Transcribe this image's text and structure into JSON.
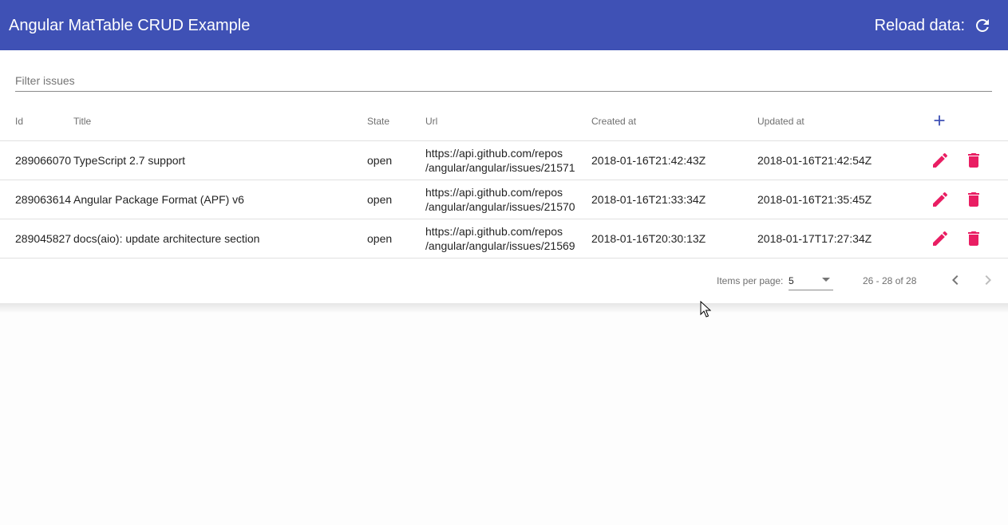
{
  "toolbar": {
    "title": "Angular MatTable CRUD Example",
    "reload_label": "Reload data:",
    "reload_icon": "refresh-icon",
    "background": "#3f51b5"
  },
  "filter": {
    "placeholder": "Filter issues",
    "value": ""
  },
  "table": {
    "columns": [
      "Id",
      "Title",
      "State",
      "Url",
      "Created at",
      "Updated at"
    ],
    "add_icon": "add-icon",
    "action_color": "#e91e63",
    "rows": [
      {
        "id": "289066070",
        "title": "TypeScript 2.7 support",
        "state": "open",
        "url_line1": "https://api.github.com/repos",
        "url_line2": "/angular/angular/issues/21571",
        "created_at": "2018-01-16T21:42:43Z",
        "updated_at": "2018-01-16T21:42:54Z"
      },
      {
        "id": "289063614",
        "title": "Angular Package Format (APF) v6",
        "state": "open",
        "url_line1": "https://api.github.com/repos",
        "url_line2": "/angular/angular/issues/21570",
        "created_at": "2018-01-16T21:33:34Z",
        "updated_at": "2018-01-16T21:35:45Z"
      },
      {
        "id": "289045827",
        "title": "docs(aio): update architecture section",
        "state": "open",
        "url_line1": "https://api.github.com/repos",
        "url_line2": "/angular/angular/issues/21569",
        "created_at": "2018-01-16T20:30:13Z",
        "updated_at": "2018-01-17T17:27:34Z"
      }
    ]
  },
  "paginator": {
    "items_per_page_label": "Items per page:",
    "page_size": "5",
    "range_label": "26 - 28 of 28"
  }
}
